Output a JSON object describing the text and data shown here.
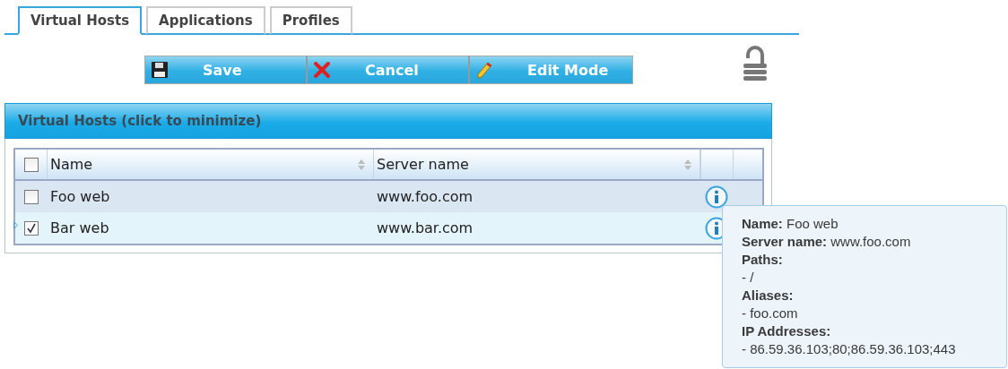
{
  "tabs": [
    {
      "label": "Virtual Hosts",
      "selected": true
    },
    {
      "label": "Applications",
      "selected": false
    },
    {
      "label": "Profiles",
      "selected": false
    }
  ],
  "toolbar": {
    "buttons": [
      {
        "kind": "save",
        "label": "Save"
      },
      {
        "kind": "cancel",
        "label": "Cancel"
      },
      {
        "kind": "edit",
        "label": "Edit Mode"
      }
    ],
    "locked": false
  },
  "panel": {
    "title": "Virtual Hosts (click to minimize)",
    "table": {
      "all_checked": false,
      "columns": [
        "Name",
        "Server name"
      ],
      "rows": [
        {
          "name": "Foo web",
          "server_name": "www.foo.com",
          "checked": false,
          "current": false
        },
        {
          "name": "Bar web",
          "server_name": "www.bar.com",
          "checked": true,
          "current": true
        }
      ]
    }
  },
  "tooltip": {
    "lines": [
      "**Name:** Foo web",
      "**Server name:** www.foo.com",
      "**Paths:**",
      "- /",
      "**Aliases:**",
      "- foo.com",
      "**IP Addresses:**",
      "- 86.59.36.103;80;86.59.36.103;443"
    ]
  }
}
